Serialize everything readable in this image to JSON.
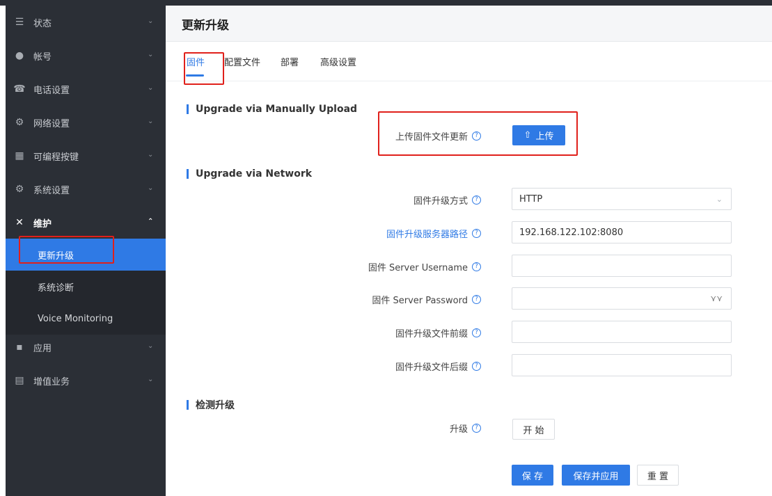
{
  "sidebar": {
    "items": [
      {
        "label": "状态",
        "icon": "list-icon"
      },
      {
        "label": "帐号",
        "icon": "user-icon"
      },
      {
        "label": "电话设置",
        "icon": "phone-icon"
      },
      {
        "label": "网络设置",
        "icon": "network-icon"
      },
      {
        "label": "可编程按键",
        "icon": "keypad-icon"
      },
      {
        "label": "系统设置",
        "icon": "system-icon"
      },
      {
        "label": "维护",
        "icon": "tools-icon"
      },
      {
        "label": "应用",
        "icon": "apps-icon"
      },
      {
        "label": "增值业务",
        "icon": "document-icon"
      }
    ],
    "sub_items": [
      {
        "label": "更新升级"
      },
      {
        "label": "系统诊断"
      },
      {
        "label": "Voice Monitoring"
      }
    ]
  },
  "header": {
    "title": "更新升级"
  },
  "tabs": [
    {
      "label": "固件"
    },
    {
      "label": "配置文件"
    },
    {
      "label": "部署"
    },
    {
      "label": "高级设置"
    }
  ],
  "sections": {
    "manual": {
      "title": "Upgrade via Manually Upload",
      "upload_label": "上传固件文件更新",
      "upload_button": "上传"
    },
    "network": {
      "title": "Upgrade via Network",
      "method_label": "固件升级方式",
      "method_value": "HTTP",
      "server_label": "固件升级服务器路径",
      "server_value": "192.168.122.102:8080",
      "username_label": "固件 Server Username",
      "username_value": "",
      "password_label": "固件 Server Password",
      "password_value": "",
      "prefix_label": "固件升级文件前缀",
      "prefix_value": "",
      "suffix_label": "固件升级文件后缀",
      "suffix_value": ""
    },
    "detect": {
      "title": "检测升级",
      "upgrade_label": "升级",
      "start_button": "开 始"
    }
  },
  "actions": {
    "save": "保 存",
    "save_apply": "保存并应用",
    "reset": "重 置"
  },
  "colors": {
    "accent": "#2f7ae5",
    "sidebar_bg": "#2b2f36",
    "highlight_red": "#e0201b"
  }
}
